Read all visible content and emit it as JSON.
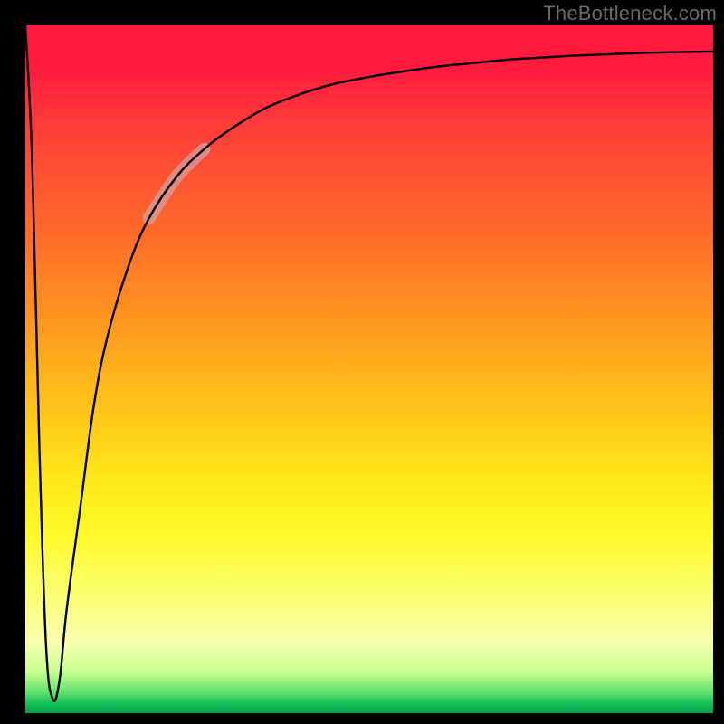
{
  "watermark": "TheBottleneck.com",
  "chart_data": {
    "type": "line",
    "title": "",
    "xlabel": "",
    "ylabel": "",
    "xlim": [
      0,
      100
    ],
    "ylim": [
      0,
      100
    ],
    "grid": false,
    "legend": false,
    "series": [
      {
        "name": "bottleneck-curve",
        "x": [
          0,
          1,
          2,
          3,
          4,
          5,
          6,
          8,
          10,
          12,
          15,
          18,
          22,
          26,
          30,
          35,
          40,
          45,
          50,
          55,
          60,
          65,
          70,
          75,
          80,
          85,
          90,
          95,
          100
        ],
        "y": [
          100,
          80,
          40,
          10,
          2,
          5,
          15,
          30,
          45,
          55,
          65,
          72,
          78,
          82,
          85,
          88,
          90,
          91.5,
          92.5,
          93.3,
          94,
          94.5,
          95,
          95.3,
          95.6,
          95.8,
          96,
          96.1,
          96.2
        ]
      }
    ],
    "highlight_segment": {
      "x_start": 18,
      "x_end": 26
    },
    "gradient_stops": [
      {
        "pct": 0,
        "color": "#ff1a3e"
      },
      {
        "pct": 30,
        "color": "#ff6a2a"
      },
      {
        "pct": 56,
        "color": "#ffc519"
      },
      {
        "pct": 74,
        "color": "#fff92a"
      },
      {
        "pct": 94,
        "color": "#c8ff90"
      },
      {
        "pct": 100,
        "color": "#05a04a"
      }
    ]
  }
}
